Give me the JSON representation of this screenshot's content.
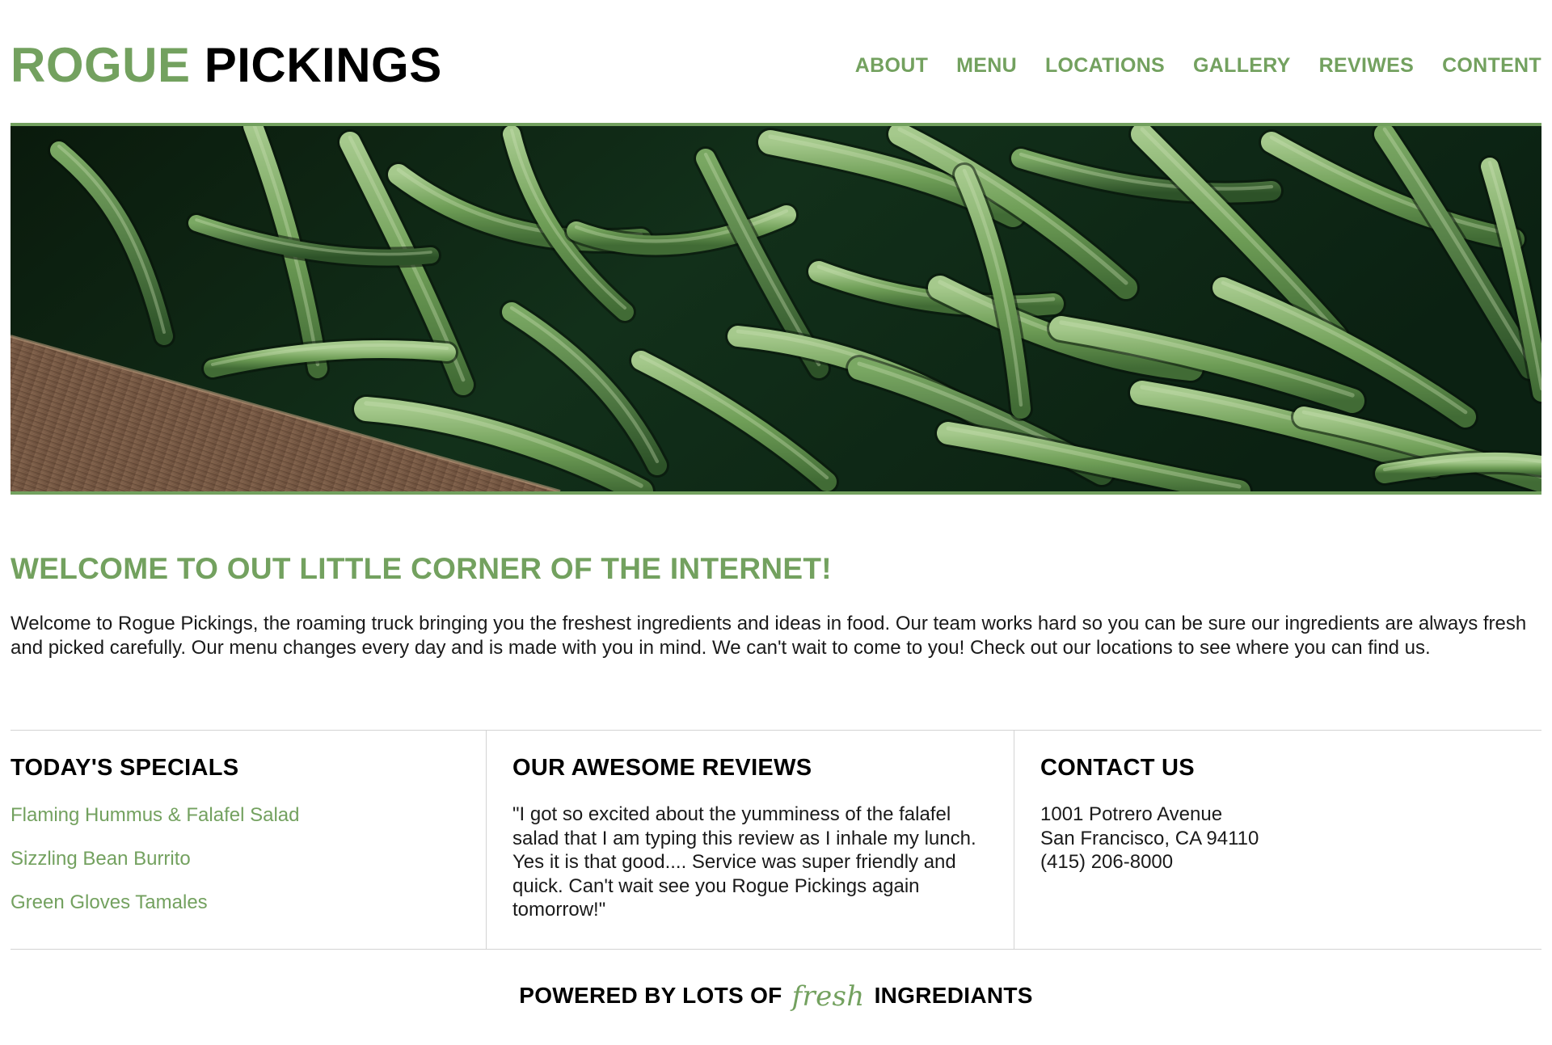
{
  "header": {
    "logo_part1": "ROGUE",
    "logo_part2": "PICKINGS",
    "nav": [
      "ABOUT",
      "MENU",
      "LOCATIONS",
      "GALLERY",
      "REVIWES",
      "CONTENT"
    ]
  },
  "hero": {
    "image": "green beans in a wooden crate"
  },
  "welcome": {
    "title": "WELCOME TO OUT LITTLE CORNER OF THE INTERNET!",
    "text": "Welcome to Rogue Pickings, the roaming truck bringing you the freshest ingredients and ideas in food. Our team works hard so you can be sure our ingredients are always fresh and picked carefully. Our menu changes every day and is made with you in mind. We can't wait to come to you! Check out our locations to see where you can find us."
  },
  "specials": {
    "title": "TODAY'S SPECIALS",
    "items": [
      "Flaming Hummus & Falafel Salad",
      "Sizzling Bean Burrito",
      "Green Gloves Tamales"
    ]
  },
  "reviews": {
    "title": "OUR AWESOME REVIEWS",
    "text": "\"I got so excited about the yumminess of the falafel salad that I am typing this review as I inhale my lunch. Yes it is that good.... Service was super friendly and quick. Can't wait see you Rogue Pickings again tomorrow!\""
  },
  "contact": {
    "title": "CONTACT US",
    "address1": "1001 Potrero Avenue",
    "address2": "San Francisco, CA 94110",
    "phone": "(415) 206-8000"
  },
  "footer": {
    "prefix": "POWERED BY LOTS OF",
    "fresh": "fresh",
    "suffix": "INGREDIANTS"
  },
  "colors": {
    "accent": "#73a15f",
    "text": "#1a1a1a",
    "divider": "#d3d3d3"
  }
}
